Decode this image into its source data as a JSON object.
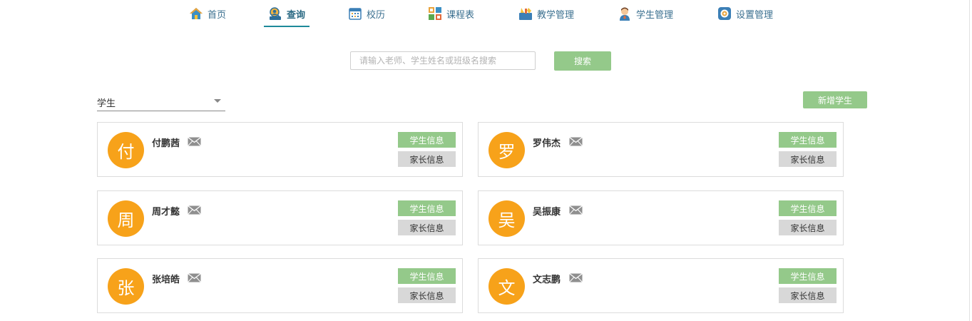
{
  "nav": {
    "items": [
      {
        "label": "首页",
        "icon": "home-icon"
      },
      {
        "label": "查询",
        "icon": "search-person-icon",
        "active": true
      },
      {
        "label": "校历",
        "icon": "calendar-icon"
      },
      {
        "label": "课程表",
        "icon": "schedule-icon"
      },
      {
        "label": "教学管理",
        "icon": "teaching-icon"
      },
      {
        "label": "学生管理",
        "icon": "student-icon"
      },
      {
        "label": "设置管理",
        "icon": "settings-icon"
      }
    ]
  },
  "search": {
    "placeholder": "请输入老师、学生姓名或班级名搜索",
    "value": "",
    "button_label": "搜索"
  },
  "filter": {
    "selected": "学生"
  },
  "add_student_label": "新增学生",
  "student_info_label": "学生信息",
  "parent_info_label": "家长信息",
  "students": [
    {
      "avatar": "付",
      "name": "付鹏茜"
    },
    {
      "avatar": "罗",
      "name": "罗伟杰"
    },
    {
      "avatar": "周",
      "name": "周才懿"
    },
    {
      "avatar": "吴",
      "name": "吴振康"
    },
    {
      "avatar": "张",
      "name": "张培皓"
    },
    {
      "avatar": "文",
      "name": "文志鹏"
    }
  ],
  "colors": {
    "accent_green": "#94c98a",
    "avatar_orange": "#f7a21a",
    "nav_text": "#3a6f8f",
    "active_underline": "#1e8a9a"
  }
}
